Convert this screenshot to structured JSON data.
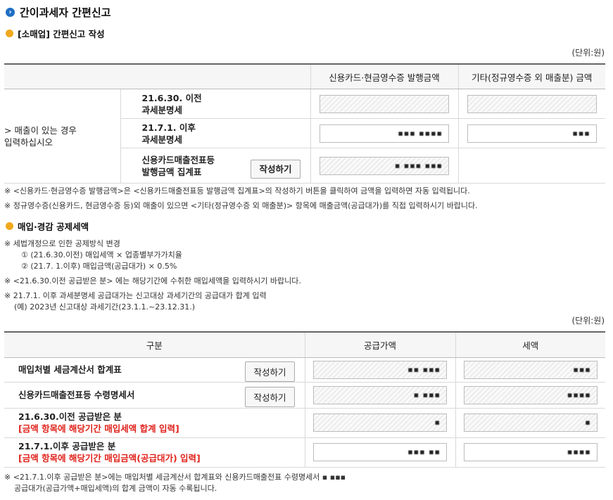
{
  "page": {
    "title": "간이과세자 간편신고",
    "title_icon": "arrow-right-circle-icon"
  },
  "section1": {
    "title": "[소매업] 간편신고 작성",
    "unit": "(단위:원)",
    "col_headers": [
      "신용카드·현금영수증 발행금액",
      "기타(정규영수증 외 매출분) 금액"
    ],
    "side_label_line1": "> 매출이 있는 경우",
    "side_label_line2": "입력하십시오",
    "rows": [
      {
        "label_line1": "21.6.30. 이전",
        "label_line2": "과세분명세",
        "val1": "",
        "val2": ""
      },
      {
        "label_line1": "21.7.1. 이후",
        "label_line2": "과세분명세",
        "val1": "▪▪▪ ▪▪▪▪",
        "val2": "▪▪▪"
      },
      {
        "label_line1": "신용카드매출전표등",
        "label_line2": "발행금액 집계표",
        "button": "작성하기",
        "val1": "▪ ▪▪▪ ▪▪▪"
      }
    ],
    "notes": [
      "※ <신용카드·현금영수증 발행금액>은 <신용카드매출전표등 발행금액 집계표>의 작성하기 버튼을 클릭하여 금액을 입력하면 자동 입력됩니다.",
      "※ 정규영수증(신용카드, 현금영수증 등)외 매출이 있으면 <기타(정규영수증 외 매출분)> 항목에 매출금액(공급대가)를 직접 입력하시기 바랍니다."
    ]
  },
  "section2": {
    "title": "매입·경감 공제세액",
    "notes": {
      "change_title": "※ 세법개정으로 인한 공제방식 변경",
      "change_item1": "① (21.6.30.이전) 매입세액 × 업종별부가가치율",
      "change_item2": "② (21.7. 1.이후) 매입금액(공급대가) × 0.5%",
      "note2": "※ <21.6.30.이전 공급받은 분> 에는 해당기간에 수취한 매입세액을 입력하시기 바랍니다.",
      "note3_line1": "※ 21.7.1. 이후 과세분명세 공급대가는 신고대상 과세기간의 공급대가 합계 입력",
      "note3_line2": "(예) 2023년 신고대상 과세기간(23.1.1.~23.12.31.)"
    },
    "unit": "(단위:원)",
    "col_headers": [
      "구분",
      "공급가액",
      "세액"
    ],
    "rows": [
      {
        "label": "매입처별 세금계산서 합계표",
        "button": "작성하기",
        "val1": "▪▪ ▪▪▪",
        "val2": "▪▪▪"
      },
      {
        "label": "신용카드매출전표등 수령명세서",
        "button": "작성하기",
        "val1": "▪ ▪▪▪",
        "val2": "▪▪▪▪"
      },
      {
        "label": "21.6.30.이전 공급받은 분",
        "sublabel": "[금액 항목에 해당기간 매입세액 합계 입력]",
        "val1": "▪",
        "val2": "▪"
      },
      {
        "label": "21.7.1.이후 공급받은 분",
        "sublabel": "[금액 항목에 해당기간 매입금액(공급대가) 입력]",
        "val1": "▪▪▪ ▪▪",
        "val2": "▪▪▪▪"
      }
    ],
    "footer_line1": "※ <21.7.1.이후 공급받은 분>에는 매입처별 세금계산서 합계표와 신용카드매출전표 수령명세서 ▪ ▪▪▪",
    "footer_line2": "공급대가(공급가액+매입세액)의 합계 금액이 자동 수록됩니다."
  },
  "colors": {
    "title_icon": "#1f6fc5",
    "section_dot": "#f0a81d",
    "warning_text": "#e0231c"
  }
}
